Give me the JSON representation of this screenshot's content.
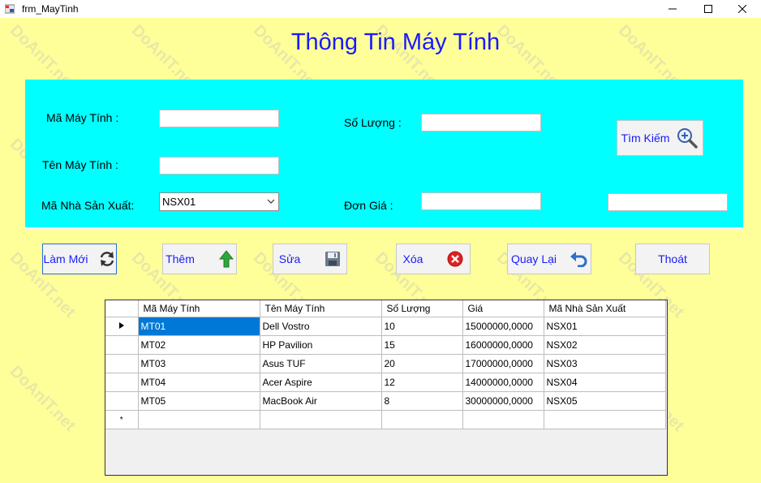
{
  "window": {
    "title": "frm_MayTinh"
  },
  "form": {
    "title": "Thông Tin Máy Tính",
    "labels": {
      "ma_may_tinh": "Mã Máy Tính :",
      "ten_may_tinh": "Tên Máy Tính :",
      "ma_nsx": "Mã Nhà Sản Xuất:",
      "so_luong": "Số Lượng :",
      "don_gia": "Đơn Giá :"
    },
    "fields": {
      "ma_may_tinh": "",
      "ten_may_tinh": "",
      "so_luong": "",
      "don_gia": "",
      "tim_kiem": ""
    },
    "ma_nsx_selected": "NSX01",
    "search_button": "Tìm Kiếm"
  },
  "buttons": {
    "lam_moi": "Làm Mới",
    "them": "Thêm",
    "sua": "Sửa",
    "xoa": "Xóa",
    "quay_lai": "Quay Lại",
    "thoat": "Thoát"
  },
  "grid": {
    "columns": [
      "Mã Máy Tính",
      "Tên Máy Tính",
      "Số Lượng",
      "Giá",
      "Mã Nhà Sản Xuất"
    ],
    "rows": [
      [
        "MT01",
        "Dell Vostro",
        "10",
        "15000000,0000",
        "NSX01"
      ],
      [
        "MT02",
        "HP Pavilion",
        "15",
        "16000000,0000",
        "NSX02"
      ],
      [
        "MT03",
        "Asus TUF",
        "20",
        "17000000,0000",
        "NSX03"
      ],
      [
        "MT04",
        "Acer Aspire",
        "12",
        "14000000,0000",
        "NSX04"
      ],
      [
        "MT05",
        "MacBook Air",
        "8",
        "30000000,0000",
        "NSX05"
      ]
    ],
    "new_row_marker": "*"
  },
  "watermark": "DoAnIT.net"
}
